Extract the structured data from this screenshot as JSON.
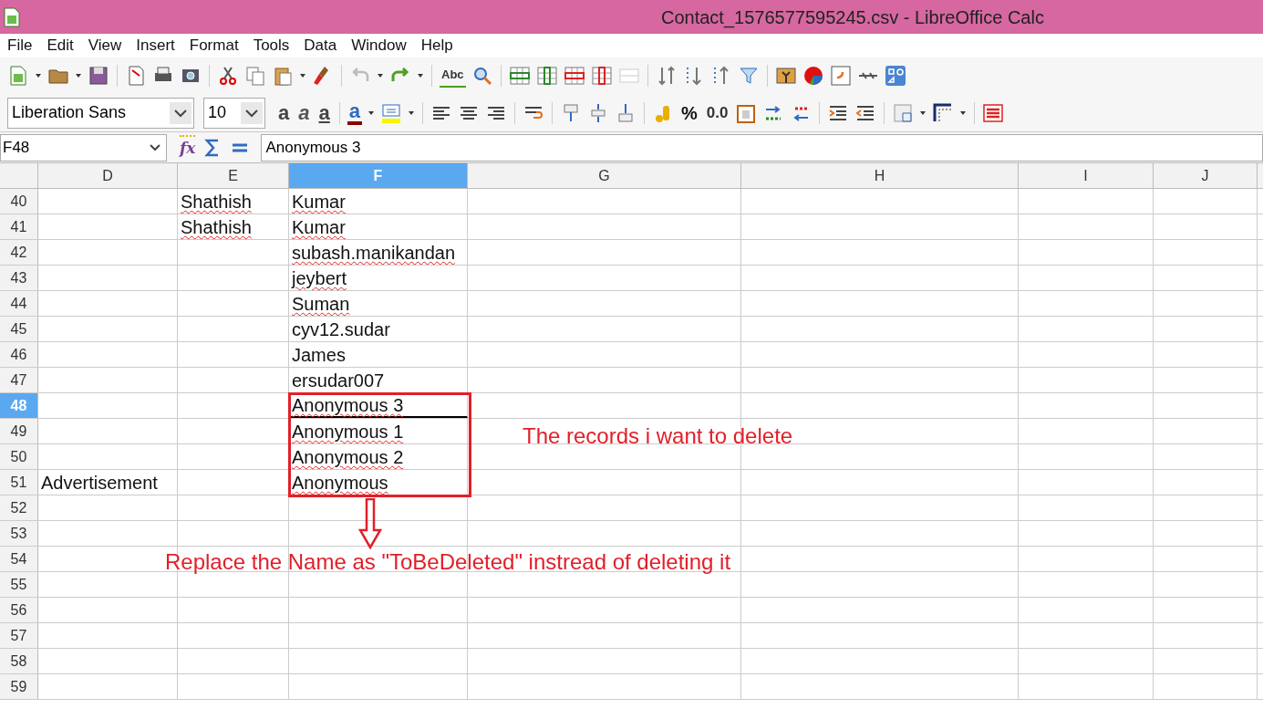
{
  "window": {
    "title": "Contact_1576577595245.csv - LibreOffice Calc"
  },
  "menu": [
    "File",
    "Edit",
    "View",
    "Insert",
    "Format",
    "Tools",
    "Data",
    "Window",
    "Help"
  ],
  "toolbar_glyphs": {
    "function_wizard": "fx",
    "spelling": "Abc",
    "bold": "a",
    "italic": "a",
    "underline": "a",
    "font_color": "a",
    "percent": "%",
    "decimal": "0.0"
  },
  "font_name": "Liberation Sans",
  "font_size": "10",
  "name_box": "F48",
  "formula": "Anonymous 3",
  "columns": [
    {
      "label": "D",
      "selected": false
    },
    {
      "label": "E",
      "selected": false
    },
    {
      "label": "F",
      "selected": true
    },
    {
      "label": "G",
      "selected": false
    },
    {
      "label": "H",
      "selected": false
    },
    {
      "label": "I",
      "selected": false
    },
    {
      "label": "J",
      "selected": false
    }
  ],
  "rows": [
    {
      "number": "40",
      "selected": false,
      "cells": {
        "E": {
          "text": "Shathish",
          "misspelled": true
        },
        "F": {
          "text": "Kumar",
          "misspelled": true
        }
      }
    },
    {
      "number": "41",
      "selected": false,
      "cells": {
        "E": {
          "text": "Shathish",
          "misspelled": true
        },
        "F": {
          "text": "Kumar",
          "misspelled": true
        }
      }
    },
    {
      "number": "42",
      "selected": false,
      "cells": {
        "F": {
          "text": "subash.manikandan",
          "misspelled": true
        }
      }
    },
    {
      "number": "43",
      "selected": false,
      "cells": {
        "F": {
          "text": "jeybert",
          "misspelled": true
        }
      }
    },
    {
      "number": "44",
      "selected": false,
      "cells": {
        "F": {
          "text": "Suman",
          "misspelled": true
        }
      }
    },
    {
      "number": "45",
      "selected": false,
      "cells": {
        "F": {
          "text": "cyv12.sudar",
          "misspelled": false
        }
      }
    },
    {
      "number": "46",
      "selected": false,
      "cells": {
        "F": {
          "text": "James",
          "misspelled": false
        }
      }
    },
    {
      "number": "47",
      "selected": false,
      "cells": {
        "F": {
          "text": "ersudar007",
          "misspelled": false
        }
      }
    },
    {
      "number": "48",
      "selected": true,
      "cells": {
        "F": {
          "text": "Anonymous 3",
          "misspelled": true
        }
      }
    },
    {
      "number": "49",
      "selected": false,
      "cells": {
        "F": {
          "text": "Anonymous 1",
          "misspelled": true
        }
      }
    },
    {
      "number": "50",
      "selected": false,
      "cells": {
        "F": {
          "text": "Anonymous 2",
          "misspelled": true
        }
      }
    },
    {
      "number": "51",
      "selected": false,
      "cells": {
        "D": {
          "text": "Advertisement",
          "misspelled": false
        },
        "F": {
          "text": "Anonymous",
          "misspelled": true
        }
      }
    },
    {
      "number": "52",
      "selected": false,
      "cells": {}
    },
    {
      "number": "53",
      "selected": false,
      "cells": {}
    },
    {
      "number": "54",
      "selected": false,
      "cells": {}
    },
    {
      "number": "55",
      "selected": false,
      "cells": {}
    },
    {
      "number": "56",
      "selected": false,
      "cells": {}
    },
    {
      "number": "57",
      "selected": false,
      "cells": {}
    },
    {
      "number": "58",
      "selected": false,
      "cells": {}
    },
    {
      "number": "59",
      "selected": false,
      "cells": {}
    }
  ],
  "annotations": {
    "note": "The records i want to delete",
    "instruction": "Replace the Name as \"ToBeDeleted\" instread of deleting it"
  }
}
